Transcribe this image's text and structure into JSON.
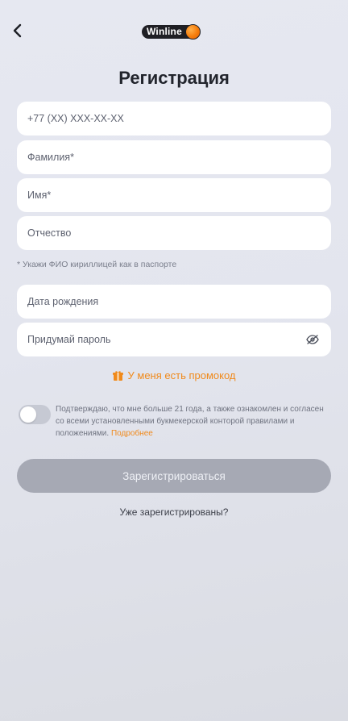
{
  "header": {
    "logo_text": "Winline"
  },
  "title": "Регистрация",
  "form": {
    "phone_placeholder": "+77 (XX) XXX-XX-XX",
    "lastname_placeholder": "Фамилия*",
    "firstname_placeholder": "Имя*",
    "patronymic_placeholder": "Отчество",
    "name_hint": "* Укажи ФИО кириллицей как в паспорте",
    "birthdate_placeholder": "Дата рождения",
    "password_placeholder": "Придумай пароль"
  },
  "promo": {
    "label": "У меня есть промокод"
  },
  "consent": {
    "text": "Подтверждаю, что мне больше 21 года, а также ознакомлен и согласен со всеми установленными букмекерской конторой правилами и положениями.",
    "link": "Подробнее",
    "enabled": false
  },
  "submit_label": "Зарегистрироваться",
  "login_label": "Уже зарегистрированы?",
  "colors": {
    "accent": "#f08a1c",
    "button_disabled": "#a6a9b4",
    "background": "#e4e6ef"
  },
  "icons": {
    "back": "chevron-left-icon",
    "password_toggle": "eye-slash-icon",
    "promo": "gift-icon"
  }
}
